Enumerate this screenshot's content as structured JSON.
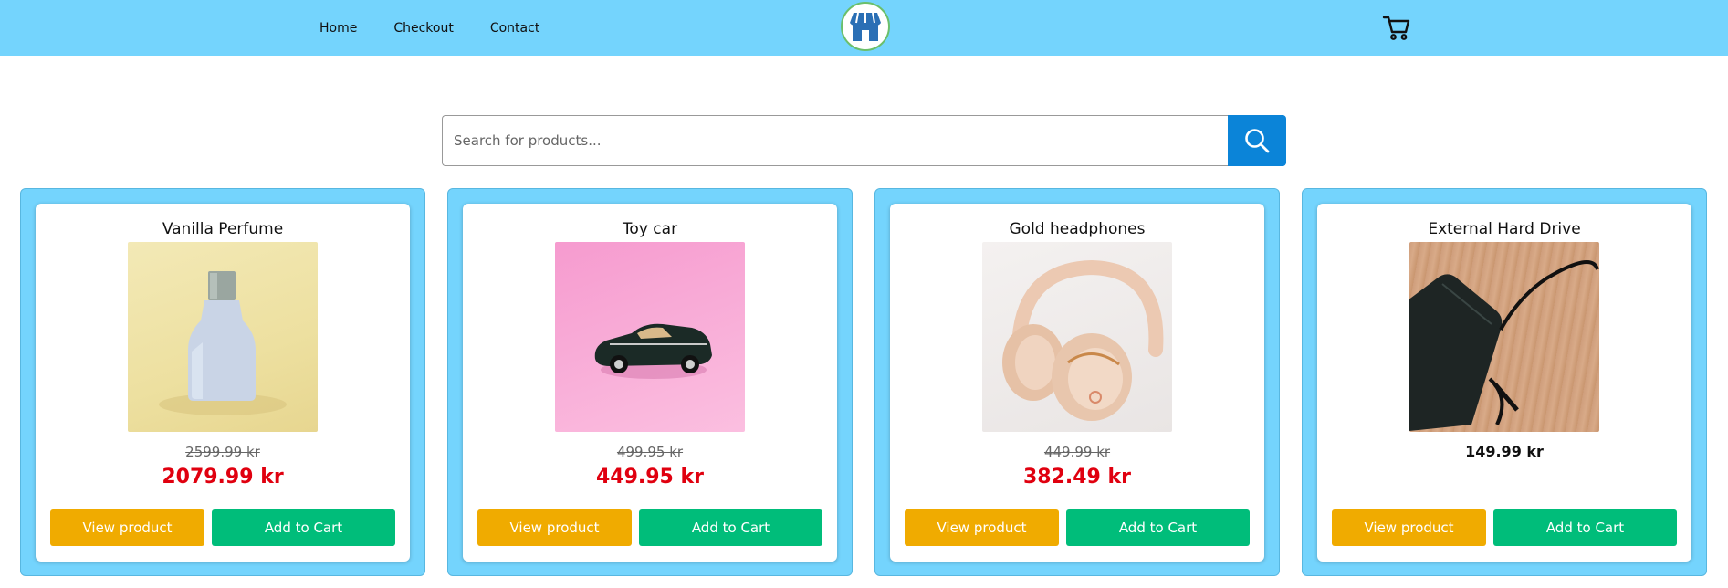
{
  "nav": {
    "links": [
      {
        "label": "Home"
      },
      {
        "label": "Checkout"
      },
      {
        "label": "Contact"
      }
    ],
    "logo_icon": "store-icon",
    "cart_icon": "shopping-cart-icon"
  },
  "search": {
    "placeholder": "Search for products...",
    "value": "",
    "button_icon": "search-icon"
  },
  "products": [
    {
      "title": "Vanilla Perfume",
      "old_price": "2599.99 kr",
      "price": "2079.99 kr",
      "view_label": "View product",
      "cart_label": "Add to Cart"
    },
    {
      "title": "Toy car",
      "old_price": "499.95 kr",
      "price": "449.95 kr",
      "view_label": "View product",
      "cart_label": "Add to Cart"
    },
    {
      "title": "Gold headphones",
      "old_price": "449.99 kr",
      "price": "382.49 kr",
      "view_label": "View product",
      "cart_label": "Add to Cart"
    },
    {
      "title": "External Hard Drive",
      "old_price": "",
      "price": "149.99 kr",
      "view_label": "View product",
      "cart_label": "Add to Cart"
    }
  ],
  "colors": {
    "header": "#74d4fd",
    "sale_price": "#e0000f",
    "view_button": "#f0ab00",
    "cart_button": "#00bd7a",
    "search_button": "#0b84d8"
  }
}
